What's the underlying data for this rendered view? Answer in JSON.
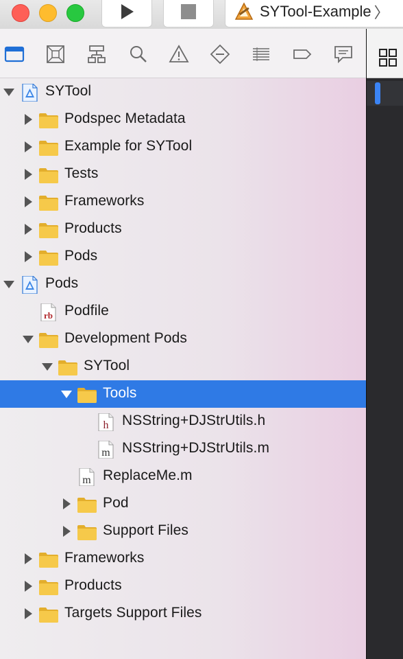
{
  "window": {
    "scheme_label": "SYTool-Example",
    "scheme_chevron": "〉"
  },
  "toolbar": {
    "traffic_lights": [
      "close",
      "minimize",
      "zoom"
    ],
    "run_icon": "play-icon",
    "stop_icon": "stop-icon"
  },
  "navigator_tabs": [
    {
      "name": "project-navigator",
      "icon": "folder-icon",
      "active": true
    },
    {
      "name": "source-control-navigator",
      "icon": "source-control-icon",
      "active": false
    },
    {
      "name": "symbol-navigator",
      "icon": "hierarchy-icon",
      "active": false
    },
    {
      "name": "find-navigator",
      "icon": "magnifier-icon",
      "active": false
    },
    {
      "name": "issue-navigator",
      "icon": "warning-icon",
      "active": false
    },
    {
      "name": "test-navigator",
      "icon": "diamond-icon",
      "active": false
    },
    {
      "name": "debug-navigator",
      "icon": "list-icon",
      "active": false
    },
    {
      "name": "breakpoint-navigator",
      "icon": "breakpoint-icon",
      "active": false
    },
    {
      "name": "report-navigator",
      "icon": "message-icon",
      "active": false
    }
  ],
  "tree": [
    {
      "label": "SYTool",
      "kind": "project",
      "depth": 0,
      "disclosure": "open"
    },
    {
      "label": "Podspec Metadata",
      "kind": "folder",
      "depth": 1,
      "disclosure": "closed"
    },
    {
      "label": "Example for SYTool",
      "kind": "folder",
      "depth": 1,
      "disclosure": "closed"
    },
    {
      "label": "Tests",
      "kind": "folder",
      "depth": 1,
      "disclosure": "closed"
    },
    {
      "label": "Frameworks",
      "kind": "folder",
      "depth": 1,
      "disclosure": "closed"
    },
    {
      "label": "Products",
      "kind": "folder",
      "depth": 1,
      "disclosure": "closed"
    },
    {
      "label": "Pods",
      "kind": "folder",
      "depth": 1,
      "disclosure": "closed"
    },
    {
      "label": "Pods",
      "kind": "project",
      "depth": 0,
      "disclosure": "open"
    },
    {
      "label": "Podfile",
      "kind": "ruby",
      "depth": 1,
      "disclosure": "none",
      "badge": "rb"
    },
    {
      "label": "Development Pods",
      "kind": "folder",
      "depth": 1,
      "disclosure": "open"
    },
    {
      "label": "SYTool",
      "kind": "folder",
      "depth": 2,
      "disclosure": "open"
    },
    {
      "label": "Tools",
      "kind": "folder",
      "depth": 3,
      "disclosure": "open",
      "selected": true
    },
    {
      "label": "NSString+DJStrUtils.h",
      "kind": "header",
      "depth": 4,
      "disclosure": "none",
      "badge": "h"
    },
    {
      "label": "NSString+DJStrUtils.m",
      "kind": "source",
      "depth": 4,
      "disclosure": "none",
      "badge": "m"
    },
    {
      "label": "ReplaceMe.m",
      "kind": "source",
      "depth": 3,
      "disclosure": "none",
      "badge": "m"
    },
    {
      "label": "Pod",
      "kind": "folder",
      "depth": 3,
      "disclosure": "closed"
    },
    {
      "label": "Support Files",
      "kind": "folder",
      "depth": 3,
      "disclosure": "closed"
    },
    {
      "label": "Frameworks",
      "kind": "folder",
      "depth": 1,
      "disclosure": "closed"
    },
    {
      "label": "Products",
      "kind": "folder",
      "depth": 1,
      "disclosure": "closed"
    },
    {
      "label": "Targets Support Files",
      "kind": "folder",
      "depth": 1,
      "disclosure": "closed"
    }
  ],
  "colors": {
    "selection": "#2f7ae5",
    "folder": "#f6c94a",
    "active_tab": "#1f6fd6"
  }
}
